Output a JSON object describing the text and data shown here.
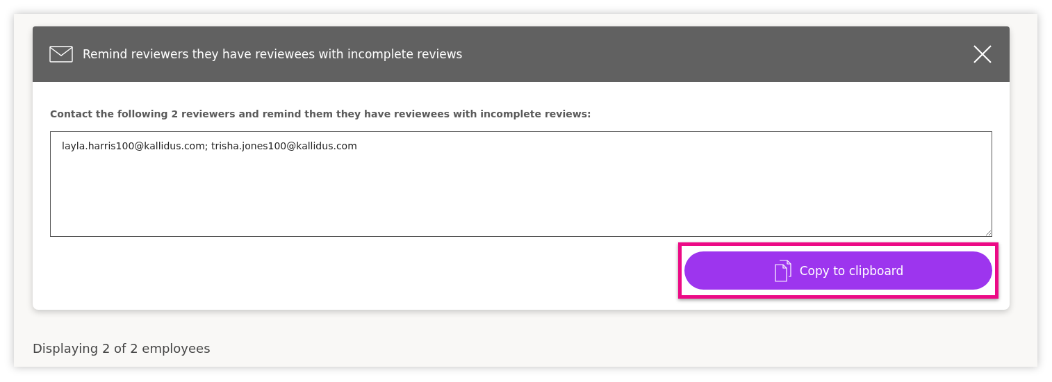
{
  "dialog": {
    "title": "Remind reviewers they have reviewees with incomplete reviews",
    "instruction": "Contact the following 2 reviewers and remind them they have reviewees with incomplete reviews:",
    "recipients": {
      "value": "layla.harris100@kallidus.com; trisha.jones100@kallidus.com"
    },
    "copy_button": {
      "label": "Copy to clipboard",
      "highlighted": true
    }
  },
  "footer": {
    "count_text": "Displaying 2 of 2 employees"
  }
}
